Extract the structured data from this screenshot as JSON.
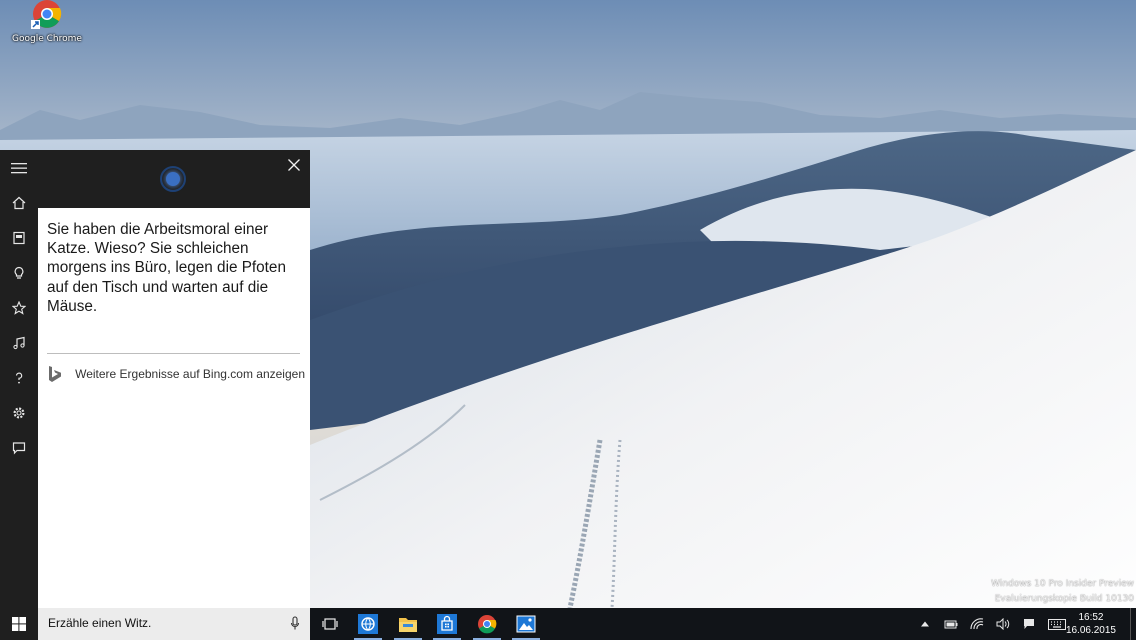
{
  "desktop": {
    "icons": [
      {
        "label": "Google Chrome",
        "icon": "chrome-shortcut-icon"
      }
    ],
    "watermark": {
      "line1": "Windows 10 Pro Insider Preview",
      "line2": "Evaluierungskopie Build 10130"
    }
  },
  "cortana": {
    "rail": [
      "hamburger-menu-icon",
      "home-icon",
      "notebook-icon",
      "lightbulb-icon",
      "star-icon",
      "music-icon",
      "help-icon",
      "settings-icon",
      "feedback-icon"
    ],
    "answer": "Sie haben die Arbeitsmoral einer Katze. Wieso? Sie schleichen morgens ins Büro, legen die Pfoten auf den Tisch und warten auf die Mäuse.",
    "bing_link": "Weitere Ergebnisse auf Bing.com anzeigen",
    "search_query": "Erzähle einen Witz.",
    "accent_color": "#3a6fc2"
  },
  "taskbar": {
    "apps": [
      "task-view-icon",
      "edge-browser-icon",
      "file-explorer-icon",
      "store-icon",
      "chrome-icon",
      "photos-icon"
    ],
    "tray": [
      "show-hidden-icons",
      "battery-icon",
      "network-icon",
      "volume-icon",
      "action-center-icon",
      "keyboard-icon"
    ],
    "time": "16:52",
    "date": "16.06.2015"
  }
}
